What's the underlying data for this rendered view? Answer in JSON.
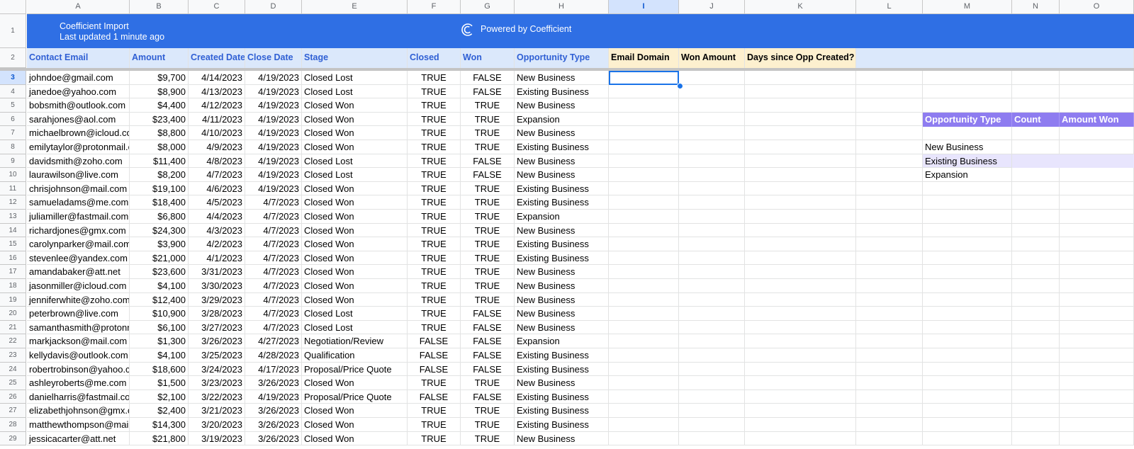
{
  "columns": [
    "A",
    "B",
    "C",
    "D",
    "E",
    "F",
    "G",
    "H",
    "I",
    "J",
    "K",
    "L",
    "M",
    "N",
    "O"
  ],
  "selected_column": "I",
  "selected_row": "3",
  "row_numbers": [
    "1",
    "2",
    "3",
    "4",
    "5",
    "6",
    "7",
    "8",
    "9",
    "10",
    "11",
    "12",
    "13",
    "14",
    "15",
    "16",
    "17",
    "18",
    "19",
    "20",
    "21",
    "22",
    "23",
    "24",
    "25",
    "26",
    "27",
    "28",
    "29"
  ],
  "banner": {
    "title": "Coefficient Import",
    "subtitle": "Last updated 1 minute ago",
    "powered_by": "Powered by Coefficient",
    "color": "#2f6fe4"
  },
  "headers": [
    "Contact Email",
    "Amount",
    "Created Date",
    "Close Date",
    "Stage",
    "Closed",
    "Won",
    "Opportunity Type",
    "Email Domain",
    "Won Amount",
    "Days since Opp Created?"
  ],
  "rows": [
    [
      "johndoe@gmail.com",
      "$9,700",
      "4/14/2023",
      "4/19/2023",
      "Closed Lost",
      "TRUE",
      "FALSE",
      "New Business"
    ],
    [
      "janedoe@yahoo.com",
      "$8,900",
      "4/13/2023",
      "4/19/2023",
      "Closed Lost",
      "TRUE",
      "FALSE",
      "Existing Business"
    ],
    [
      "bobsmith@outlook.com",
      "$4,400",
      "4/12/2023",
      "4/19/2023",
      "Closed Won",
      "TRUE",
      "TRUE",
      "New Business"
    ],
    [
      "sarahjones@aol.com",
      "$23,400",
      "4/11/2023",
      "4/19/2023",
      "Closed Won",
      "TRUE",
      "TRUE",
      "Expansion"
    ],
    [
      "michaelbrown@icloud.com",
      "$8,800",
      "4/10/2023",
      "4/19/2023",
      "Closed Won",
      "TRUE",
      "TRUE",
      "New Business"
    ],
    [
      "emilytaylor@protonmail.com",
      "$8,000",
      "4/9/2023",
      "4/19/2023",
      "Closed Won",
      "TRUE",
      "TRUE",
      "Existing Business"
    ],
    [
      "davidsmith@zoho.com",
      "$11,400",
      "4/8/2023",
      "4/19/2023",
      "Closed Lost",
      "TRUE",
      "FALSE",
      "New Business"
    ],
    [
      "laurawilson@live.com",
      "$8,200",
      "4/7/2023",
      "4/19/2023",
      "Closed Lost",
      "TRUE",
      "FALSE",
      "New Business"
    ],
    [
      "chrisjohnson@mail.com",
      "$19,100",
      "4/6/2023",
      "4/19/2023",
      "Closed Won",
      "TRUE",
      "TRUE",
      "Existing Business"
    ],
    [
      "samueladams@me.com",
      "$18,400",
      "4/5/2023",
      "4/7/2023",
      "Closed Won",
      "TRUE",
      "TRUE",
      "Existing Business"
    ],
    [
      "juliamiller@fastmail.com",
      "$6,800",
      "4/4/2023",
      "4/7/2023",
      "Closed Won",
      "TRUE",
      "TRUE",
      "Expansion"
    ],
    [
      "richardjones@gmx.com",
      "$24,300",
      "4/3/2023",
      "4/7/2023",
      "Closed Won",
      "TRUE",
      "TRUE",
      "New Business"
    ],
    [
      "carolynparker@mail.com",
      "$3,900",
      "4/2/2023",
      "4/7/2023",
      "Closed Won",
      "TRUE",
      "TRUE",
      "Existing Business"
    ],
    [
      "stevenlee@yandex.com",
      "$21,000",
      "4/1/2023",
      "4/7/2023",
      "Closed Won",
      "TRUE",
      "TRUE",
      "Existing Business"
    ],
    [
      "amandabaker@att.net",
      "$23,600",
      "3/31/2023",
      "4/7/2023",
      "Closed Won",
      "TRUE",
      "TRUE",
      "New Business"
    ],
    [
      "jasonmiller@icloud.com",
      "$4,100",
      "3/30/2023",
      "4/7/2023",
      "Closed Won",
      "TRUE",
      "TRUE",
      "New Business"
    ],
    [
      "jenniferwhite@zoho.com",
      "$12,400",
      "3/29/2023",
      "4/7/2023",
      "Closed Won",
      "TRUE",
      "TRUE",
      "New Business"
    ],
    [
      "peterbrown@live.com",
      "$10,900",
      "3/28/2023",
      "4/7/2023",
      "Closed Lost",
      "TRUE",
      "FALSE",
      "New Business"
    ],
    [
      "samanthasmith@protonmail.com",
      "$6,100",
      "3/27/2023",
      "4/7/2023",
      "Closed Lost",
      "TRUE",
      "FALSE",
      "New Business"
    ],
    [
      "markjackson@mail.com",
      "$1,300",
      "3/26/2023",
      "4/27/2023",
      "Negotiation/Review",
      "FALSE",
      "FALSE",
      "Expansion"
    ],
    [
      "kellydavis@outlook.com",
      "$4,100",
      "3/25/2023",
      "4/28/2023",
      "Qualification",
      "FALSE",
      "FALSE",
      "Existing Business"
    ],
    [
      "robertrobinson@yahoo.com",
      "$18,600",
      "3/24/2023",
      "4/17/2023",
      "Proposal/Price Quote",
      "FALSE",
      "FALSE",
      "Existing Business"
    ],
    [
      "ashleyroberts@me.com",
      "$1,500",
      "3/23/2023",
      "3/26/2023",
      "Closed Won",
      "TRUE",
      "TRUE",
      "New Business"
    ],
    [
      "danielharris@fastmail.com",
      "$2,100",
      "3/22/2023",
      "4/19/2023",
      "Proposal/Price Quote",
      "FALSE",
      "FALSE",
      "Existing Business"
    ],
    [
      "elizabethjohnson@gmx.com",
      "$2,400",
      "3/21/2023",
      "3/26/2023",
      "Closed Won",
      "TRUE",
      "TRUE",
      "Existing Business"
    ],
    [
      "matthewthompson@mail.com",
      "$14,300",
      "3/20/2023",
      "3/26/2023",
      "Closed Won",
      "TRUE",
      "TRUE",
      "Existing Business"
    ],
    [
      "jessicacarter@att.net",
      "$21,800",
      "3/19/2023",
      "3/26/2023",
      "Closed Won",
      "TRUE",
      "TRUE",
      "New Business"
    ]
  ],
  "summary": {
    "headers": [
      "Opportunity Type",
      "Count",
      "Amount Won"
    ],
    "rows": [
      "New Business",
      "Existing Business",
      "Expansion"
    ],
    "header_color": "#8e7cf0",
    "band_color": "#e8e5fd"
  }
}
